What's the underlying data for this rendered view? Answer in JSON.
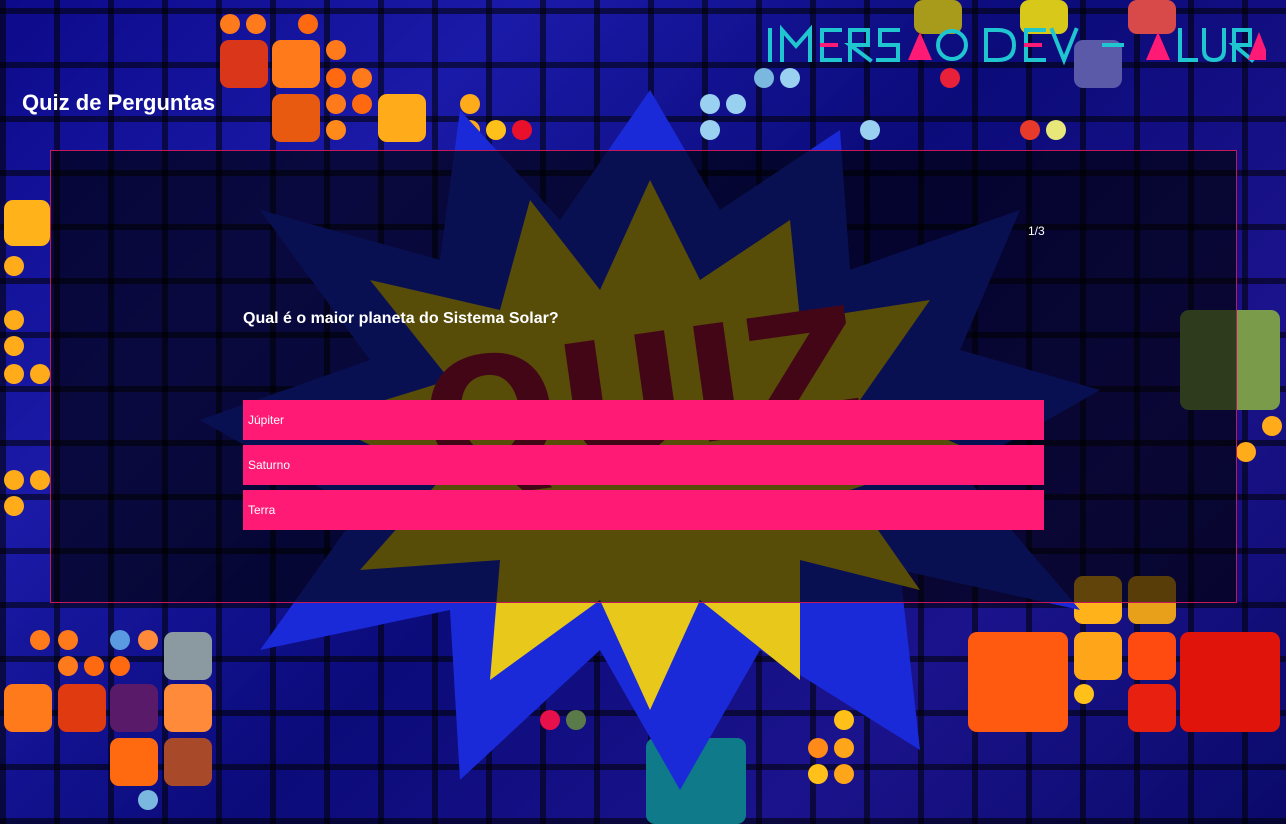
{
  "brand": {
    "logo_text": "IMERSAO DEV - ALURA",
    "colors": {
      "primary": "#1fc6cf",
      "accent": "#ff1a75"
    }
  },
  "page": {
    "title": "Quiz de Perguntas"
  },
  "quiz": {
    "counter": "1/3",
    "question": "Qual é o maior planeta do Sistema Solar?",
    "answers": [
      "Júpiter",
      "Saturno",
      "Terra"
    ],
    "answer_color": "#ff1a75",
    "panel_border_color": "#c2185b"
  },
  "background": {
    "icon": "quiz-burst-icon"
  }
}
